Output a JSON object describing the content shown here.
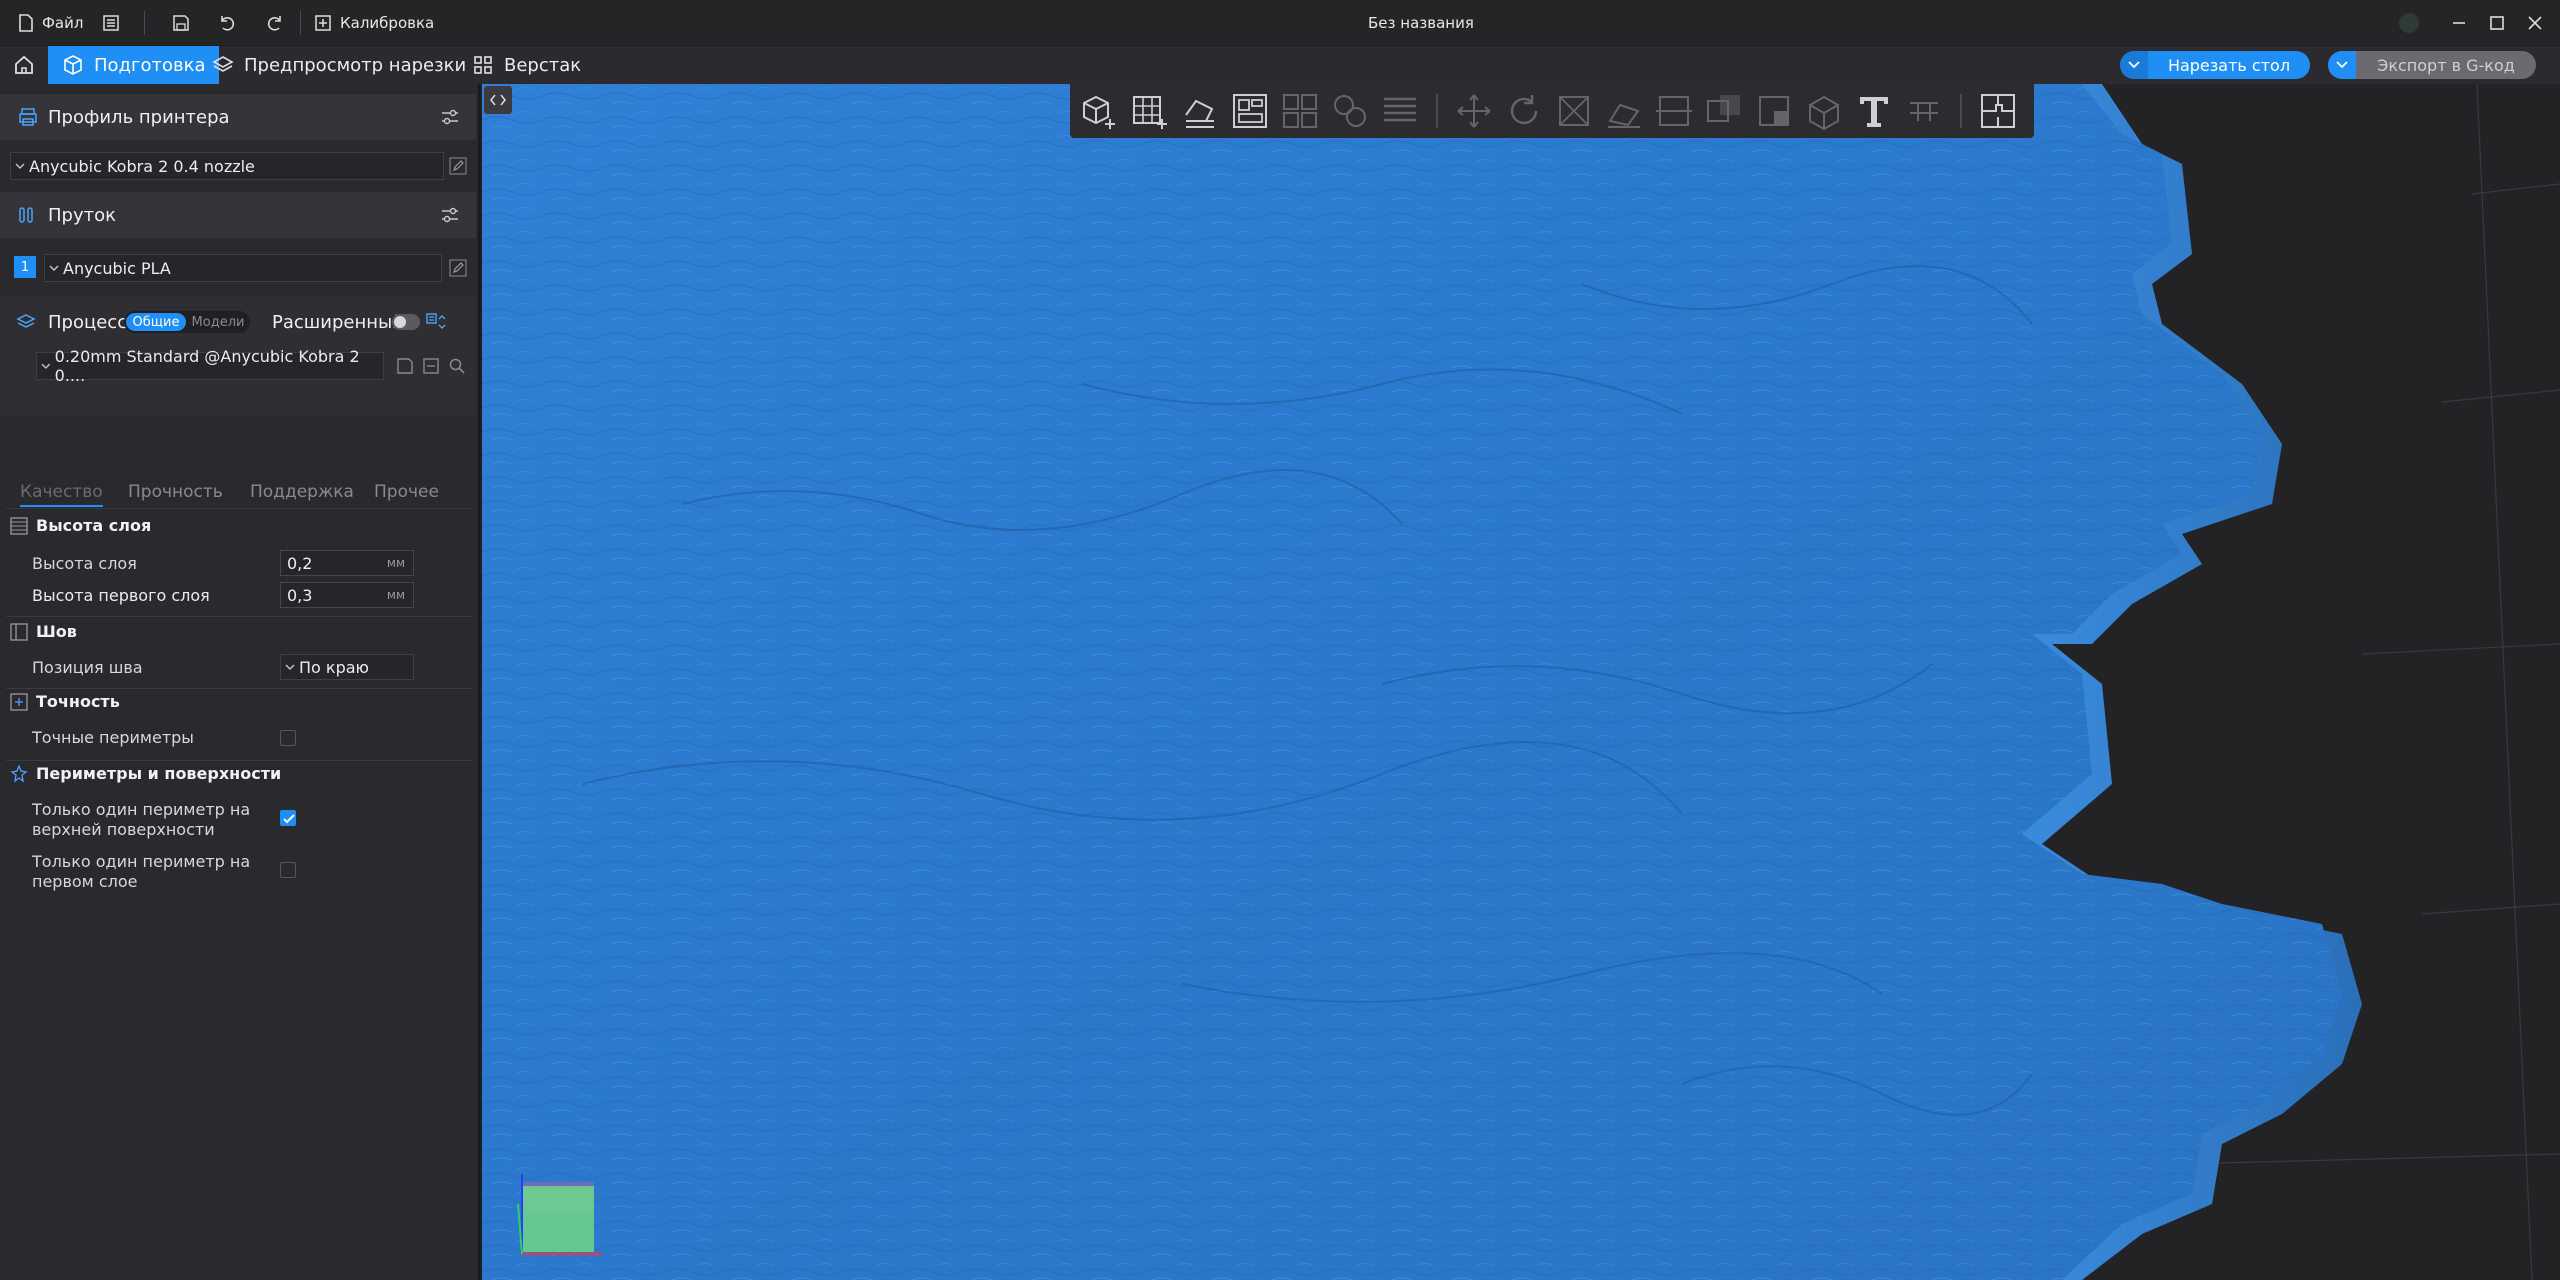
{
  "titlebar": {
    "file_label": "Файл",
    "calibration_label": "Калибровка",
    "window_title": "Без названия"
  },
  "tabs": {
    "prepare": "Подготовка",
    "preview": "Предпросмотр нарезки",
    "workbench": "Верстак"
  },
  "actions": {
    "slice": "Нарезать стол",
    "export": "Экспорт в G-код"
  },
  "printer": {
    "section_title": "Профиль принтера",
    "selected": "Anycubic Kobra 2 0.4 nozzle"
  },
  "filament": {
    "section_title": "Пруток",
    "slot": "1",
    "selected": "Anycubic PLA"
  },
  "process": {
    "section_title": "Процесс",
    "toggle_general": "Общие",
    "toggle_models": "Модели",
    "advanced_label": "Расширенный",
    "selected": "0.20mm Standard @Anycubic Kobra 2 0...."
  },
  "subtabs": [
    "Качество",
    "Прочность",
    "Поддержка",
    "Прочее"
  ],
  "settings": {
    "layer_height_group": "Высота слоя",
    "layer_height_label": "Высота слоя",
    "layer_height_value": "0,2",
    "first_layer_label": "Высота первого слоя",
    "first_layer_value": "0,3",
    "unit": "мм",
    "seam_group": "Шов",
    "seam_position_label": "Позиция шва",
    "seam_position_value": "По краю",
    "precision_group": "Точность",
    "precise_walls_label": "Точные периметры",
    "precise_walls_checked": false,
    "walls_group": "Периметры и поверхности",
    "one_wall_top_label_1": "Только один периметр на",
    "one_wall_top_label_2": "верхней поверхности",
    "one_wall_top_checked": true,
    "one_wall_first_label_1": "Только один периметр на",
    "one_wall_first_label_2": "первом слое",
    "one_wall_first_checked": false
  },
  "colors": {
    "accent": "#1f8ef5",
    "model": "#2f7fd3",
    "bed": "#232326"
  }
}
